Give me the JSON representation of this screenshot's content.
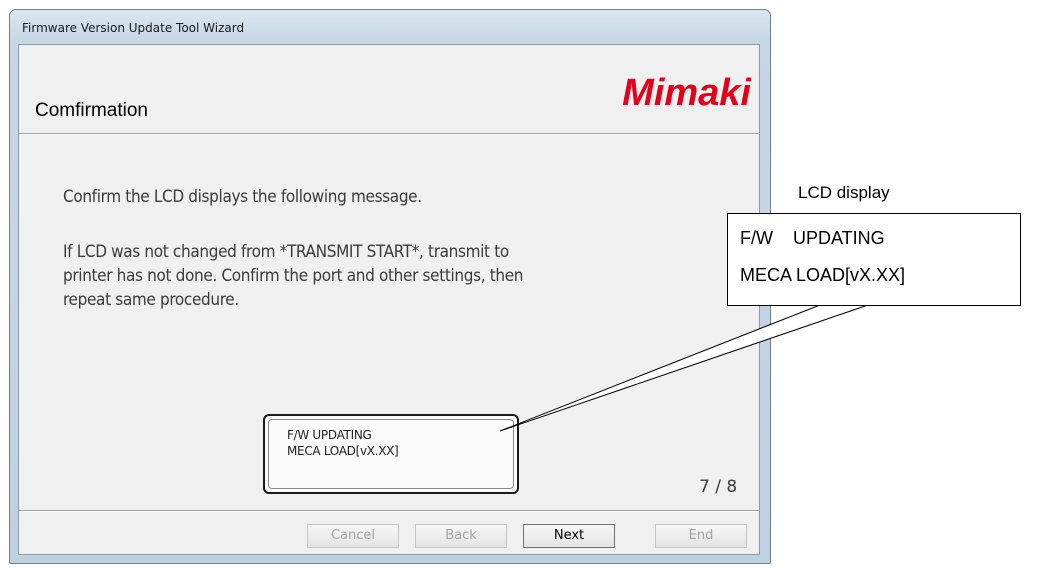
{
  "window": {
    "title": "Firmware Version Update Tool Wizard"
  },
  "header": {
    "title": "Comfirmation",
    "logo_text": "Mimaki",
    "logo_color": "#e3001b"
  },
  "main": {
    "message1": "Confirm the LCD displays the following message.",
    "message2_lines": [
      "If LCD was not changed from *TRANSMIT START*, transmit to",
      "printer has not done. Confirm the port and other settings, then",
      "repeat same procedure."
    ],
    "lcd_lines": [
      "F/W UPDATING",
      "MECA LOAD[vX.XX]"
    ],
    "page_indicator": "7 / 8"
  },
  "buttons": {
    "cancel": "Cancel",
    "back": "Back",
    "next": "Next",
    "end": "End"
  },
  "callout": {
    "label": "LCD display",
    "line1": "F/W    UPDATING",
    "line2": "MECA LOAD[vX.XX]"
  }
}
